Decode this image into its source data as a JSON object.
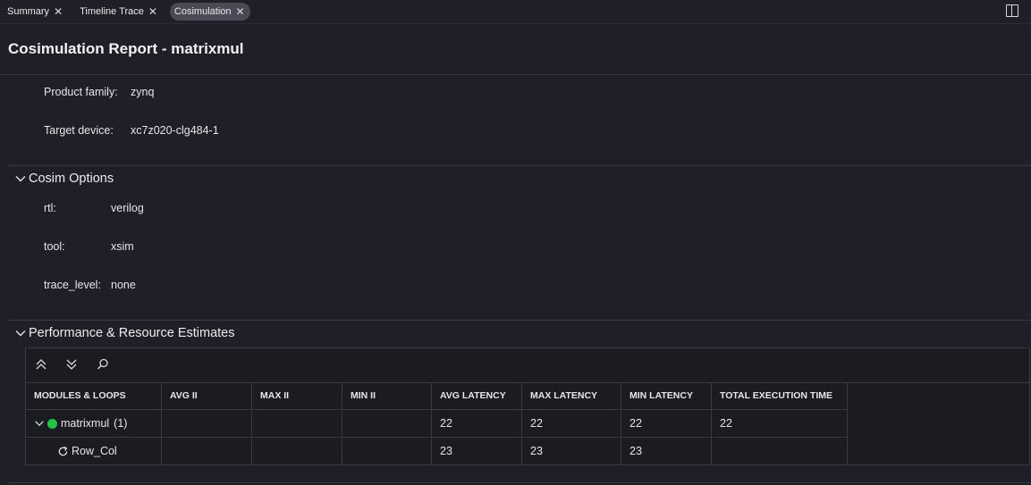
{
  "tabs": [
    {
      "label": "Summary",
      "active": false
    },
    {
      "label": "Timeline Trace",
      "active": false
    },
    {
      "label": "Cosimulation",
      "active": true
    }
  ],
  "title": "Cosimulation Report - matrixmul",
  "info": {
    "product_family_label": "Product family:",
    "product_family_value": "zynq",
    "target_device_label": "Target device:",
    "target_device_value": "xc7z020-clg484-1"
  },
  "cosim": {
    "heading": "Cosim Options",
    "rtl_label": "rtl:",
    "rtl_value": "verilog",
    "tool_label": "tool:",
    "tool_value": "xsim",
    "trace_label": "trace_level:",
    "trace_value": "none"
  },
  "perf": {
    "heading": "Performance & Resource Estimates",
    "columns": [
      "MODULES & LOOPS",
      "AVG II",
      "MAX II",
      "MIN II",
      "AVG LATENCY",
      "MAX LATENCY",
      "MIN LATENCY",
      "TOTAL EXECUTION TIME"
    ],
    "rows": [
      {
        "name": "matrixmul",
        "count": "(1)",
        "avg_ii": "",
        "max_ii": "",
        "min_ii": "",
        "avg_lat": "22",
        "max_lat": "22",
        "min_lat": "22",
        "total": "22",
        "status_color": "#22c24b"
      },
      {
        "name": "Row_Col",
        "avg_ii": "",
        "max_ii": "",
        "min_ii": "",
        "avg_lat": "23",
        "max_lat": "23",
        "min_lat": "23",
        "total": ""
      }
    ]
  },
  "icons": {
    "close": "close-icon",
    "split": "split-editor-icon",
    "collapse_all": "collapse-all-icon",
    "expand_all": "expand-all-icon",
    "search": "search-icon",
    "loop": "loop-icon",
    "chevron": "chevron-down-icon"
  }
}
